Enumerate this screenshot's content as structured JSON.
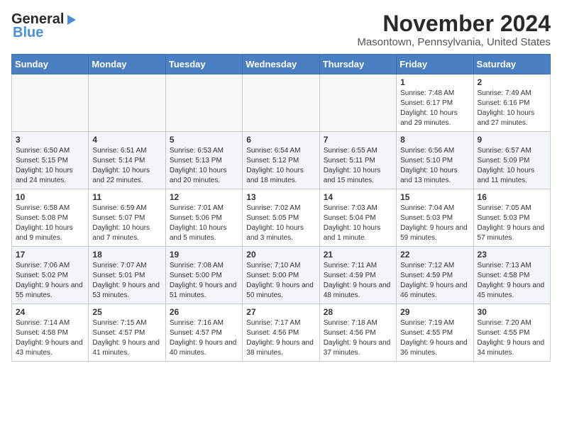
{
  "header": {
    "logo_general": "General",
    "logo_blue": "Blue",
    "title": "November 2024",
    "subtitle": "Masontown, Pennsylvania, United States"
  },
  "calendar": {
    "days_of_week": [
      "Sunday",
      "Monday",
      "Tuesday",
      "Wednesday",
      "Thursday",
      "Friday",
      "Saturday"
    ],
    "weeks": [
      [
        {
          "day": "",
          "info": ""
        },
        {
          "day": "",
          "info": ""
        },
        {
          "day": "",
          "info": ""
        },
        {
          "day": "",
          "info": ""
        },
        {
          "day": "",
          "info": ""
        },
        {
          "day": "1",
          "info": "Sunrise: 7:48 AM\nSunset: 6:17 PM\nDaylight: 10 hours and 29 minutes."
        },
        {
          "day": "2",
          "info": "Sunrise: 7:49 AM\nSunset: 6:16 PM\nDaylight: 10 hours and 27 minutes."
        }
      ],
      [
        {
          "day": "3",
          "info": "Sunrise: 6:50 AM\nSunset: 5:15 PM\nDaylight: 10 hours and 24 minutes."
        },
        {
          "day": "4",
          "info": "Sunrise: 6:51 AM\nSunset: 5:14 PM\nDaylight: 10 hours and 22 minutes."
        },
        {
          "day": "5",
          "info": "Sunrise: 6:53 AM\nSunset: 5:13 PM\nDaylight: 10 hours and 20 minutes."
        },
        {
          "day": "6",
          "info": "Sunrise: 6:54 AM\nSunset: 5:12 PM\nDaylight: 10 hours and 18 minutes."
        },
        {
          "day": "7",
          "info": "Sunrise: 6:55 AM\nSunset: 5:11 PM\nDaylight: 10 hours and 15 minutes."
        },
        {
          "day": "8",
          "info": "Sunrise: 6:56 AM\nSunset: 5:10 PM\nDaylight: 10 hours and 13 minutes."
        },
        {
          "day": "9",
          "info": "Sunrise: 6:57 AM\nSunset: 5:09 PM\nDaylight: 10 hours and 11 minutes."
        }
      ],
      [
        {
          "day": "10",
          "info": "Sunrise: 6:58 AM\nSunset: 5:08 PM\nDaylight: 10 hours and 9 minutes."
        },
        {
          "day": "11",
          "info": "Sunrise: 6:59 AM\nSunset: 5:07 PM\nDaylight: 10 hours and 7 minutes."
        },
        {
          "day": "12",
          "info": "Sunrise: 7:01 AM\nSunset: 5:06 PM\nDaylight: 10 hours and 5 minutes."
        },
        {
          "day": "13",
          "info": "Sunrise: 7:02 AM\nSunset: 5:05 PM\nDaylight: 10 hours and 3 minutes."
        },
        {
          "day": "14",
          "info": "Sunrise: 7:03 AM\nSunset: 5:04 PM\nDaylight: 10 hours and 1 minute."
        },
        {
          "day": "15",
          "info": "Sunrise: 7:04 AM\nSunset: 5:03 PM\nDaylight: 9 hours and 59 minutes."
        },
        {
          "day": "16",
          "info": "Sunrise: 7:05 AM\nSunset: 5:03 PM\nDaylight: 9 hours and 57 minutes."
        }
      ],
      [
        {
          "day": "17",
          "info": "Sunrise: 7:06 AM\nSunset: 5:02 PM\nDaylight: 9 hours and 55 minutes."
        },
        {
          "day": "18",
          "info": "Sunrise: 7:07 AM\nSunset: 5:01 PM\nDaylight: 9 hours and 53 minutes."
        },
        {
          "day": "19",
          "info": "Sunrise: 7:08 AM\nSunset: 5:00 PM\nDaylight: 9 hours and 51 minutes."
        },
        {
          "day": "20",
          "info": "Sunrise: 7:10 AM\nSunset: 5:00 PM\nDaylight: 9 hours and 50 minutes."
        },
        {
          "day": "21",
          "info": "Sunrise: 7:11 AM\nSunset: 4:59 PM\nDaylight: 9 hours and 48 minutes."
        },
        {
          "day": "22",
          "info": "Sunrise: 7:12 AM\nSunset: 4:59 PM\nDaylight: 9 hours and 46 minutes."
        },
        {
          "day": "23",
          "info": "Sunrise: 7:13 AM\nSunset: 4:58 PM\nDaylight: 9 hours and 45 minutes."
        }
      ],
      [
        {
          "day": "24",
          "info": "Sunrise: 7:14 AM\nSunset: 4:58 PM\nDaylight: 9 hours and 43 minutes."
        },
        {
          "day": "25",
          "info": "Sunrise: 7:15 AM\nSunset: 4:57 PM\nDaylight: 9 hours and 41 minutes."
        },
        {
          "day": "26",
          "info": "Sunrise: 7:16 AM\nSunset: 4:57 PM\nDaylight: 9 hours and 40 minutes."
        },
        {
          "day": "27",
          "info": "Sunrise: 7:17 AM\nSunset: 4:56 PM\nDaylight: 9 hours and 38 minutes."
        },
        {
          "day": "28",
          "info": "Sunrise: 7:18 AM\nSunset: 4:56 PM\nDaylight: 9 hours and 37 minutes."
        },
        {
          "day": "29",
          "info": "Sunrise: 7:19 AM\nSunset: 4:55 PM\nDaylight: 9 hours and 36 minutes."
        },
        {
          "day": "30",
          "info": "Sunrise: 7:20 AM\nSunset: 4:55 PM\nDaylight: 9 hours and 34 minutes."
        }
      ]
    ]
  }
}
